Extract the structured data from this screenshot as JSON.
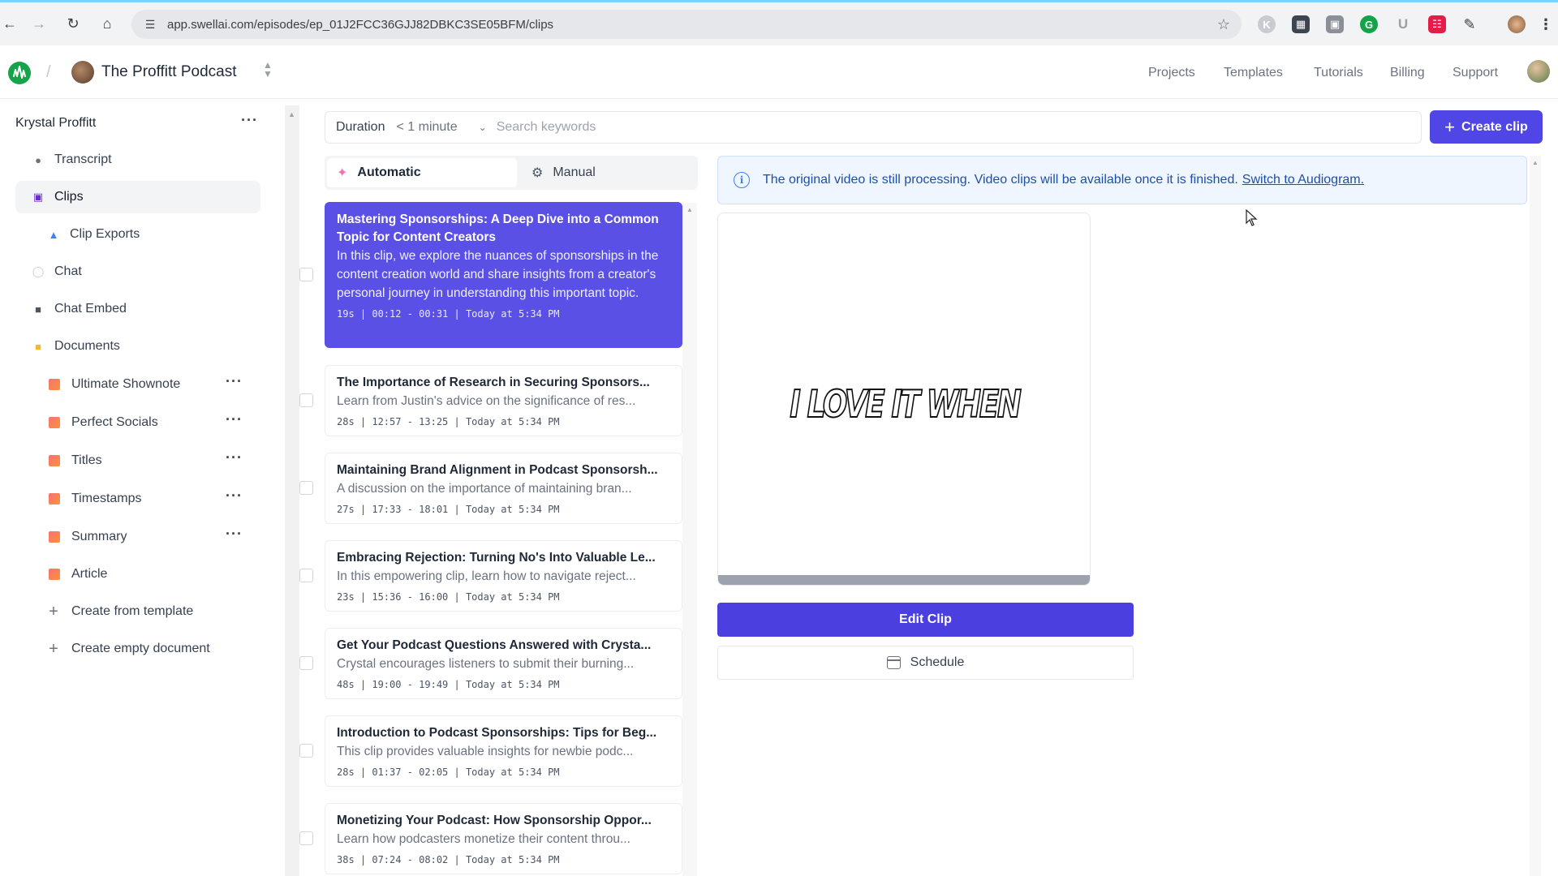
{
  "browser": {
    "url": "app.swellai.com/episodes/ep_01J2FCC36GJJ82DBKC3SE05BFM/clips"
  },
  "header": {
    "podcast_name": "The Proffitt Podcast",
    "nav": [
      "Projects",
      "Templates",
      "Tutorials",
      "Billing",
      "Support"
    ]
  },
  "sidebar": {
    "user": "Krystal Proffitt",
    "items": [
      {
        "label": "Transcript",
        "icon": "microphone-icon"
      },
      {
        "label": "Clips",
        "icon": "clapperboard-icon",
        "active": true
      },
      {
        "label": "Clip Exports",
        "icon": "export-icon"
      },
      {
        "label": "Chat",
        "icon": "chat-bubble-icon"
      },
      {
        "label": "Chat Embed",
        "icon": "robot-icon"
      },
      {
        "label": "Documents",
        "icon": "folder-icon"
      }
    ],
    "documents": [
      "Ultimate Shownote",
      "Perfect Socials",
      "Titles",
      "Timestamps",
      "Summary",
      "Article"
    ],
    "actions": [
      "Create from template",
      "Create empty document"
    ]
  },
  "filter": {
    "duration_label": "Duration",
    "duration_value": "< 1 minute",
    "search_placeholder": "Search keywords"
  },
  "create_clip_label": "Create clip",
  "tabs": [
    "Automatic",
    "Manual"
  ],
  "clips": [
    {
      "title": "Mastering Sponsorships: A Deep Dive into a Common Topic for Content Creators",
      "desc": "In this clip, we explore the nuances of sponsorships in the content creation world and share insights from a creator's personal journey in understanding this important topic.",
      "meta": "19s | 00:12 - 00:31 | Today at 5:34 PM",
      "selected": true
    },
    {
      "title": "The Importance of Research in Securing Sponsors...",
      "desc": "Learn from Justin's advice on the significance of res...",
      "meta": "28s | 12:57 - 13:25 | Today at 5:34 PM"
    },
    {
      "title": "Maintaining Brand Alignment in Podcast Sponsorsh...",
      "desc": "A discussion on the importance of maintaining bran...",
      "meta": "27s | 17:33 - 18:01 | Today at 5:34 PM"
    },
    {
      "title": "Embracing Rejection: Turning No's Into Valuable Le...",
      "desc": "In this empowering clip, learn how to navigate reject...",
      "meta": "23s | 15:36 - 16:00 | Today at 5:34 PM"
    },
    {
      "title": "Get Your Podcast Questions Answered with Crysta...",
      "desc": "Crystal encourages listeners to submit their burning...",
      "meta": "48s | 19:00 - 19:49 | Today at 5:34 PM"
    },
    {
      "title": "Introduction to Podcast Sponsorships: Tips for Beg...",
      "desc": "This clip provides valuable insights for newbie podc...",
      "meta": "28s | 01:37 - 02:05 | Today at 5:34 PM"
    },
    {
      "title": "Monetizing Your Podcast: How Sponsorship Oppor...",
      "desc": "Learn how podcasters monetize their content throu...",
      "meta": "38s | 07:24 - 08:02 | Today at 5:34 PM"
    }
  ],
  "banner": {
    "message": "The original video is still processing. Video clips will be available once it is finished.",
    "link": "Switch to Audiogram."
  },
  "video": {
    "caption": "I LOVE IT WHEN"
  },
  "edit_clip_label": "Edit Clip",
  "schedule_label": "Schedule",
  "colors": {
    "accent": "#4f46e5",
    "selected_card": "#5b50e6",
    "banner_bg": "#eff6ff",
    "banner_text": "#1e4fa8"
  }
}
